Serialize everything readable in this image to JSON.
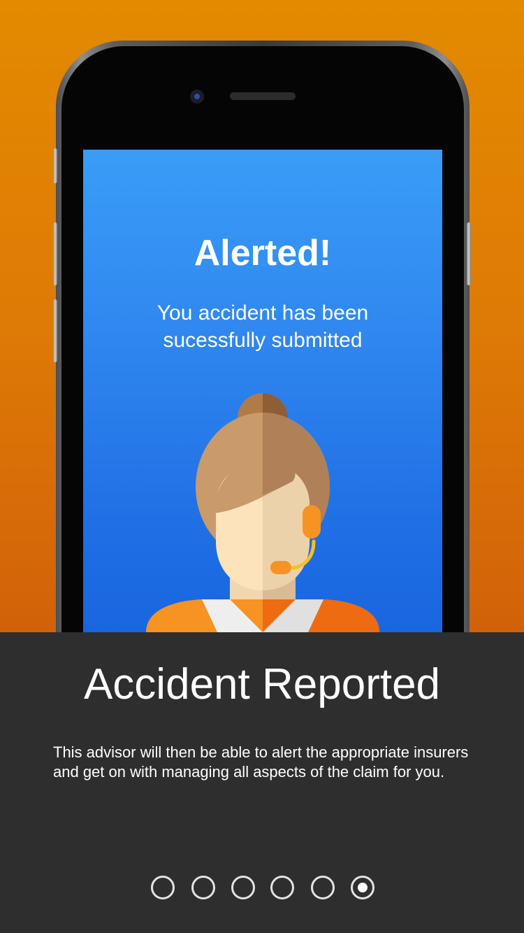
{
  "screen": {
    "title": "Alerted!",
    "subtitle": "You accident has been sucessfully submitted",
    "illustration": "customer-support-advisor-with-headset"
  },
  "panel": {
    "title": "Accident Reported",
    "body": "This advisor will then be able to alert the appropriate insurers and get on with managing all aspects of the claim for you."
  },
  "pager": {
    "total": 6,
    "current": 6
  },
  "colors": {
    "background_orange": "#e38a00",
    "screen_blue": "#2f86ef",
    "panel_dark": "#2e2e2e",
    "text_white": "#ffffff"
  }
}
